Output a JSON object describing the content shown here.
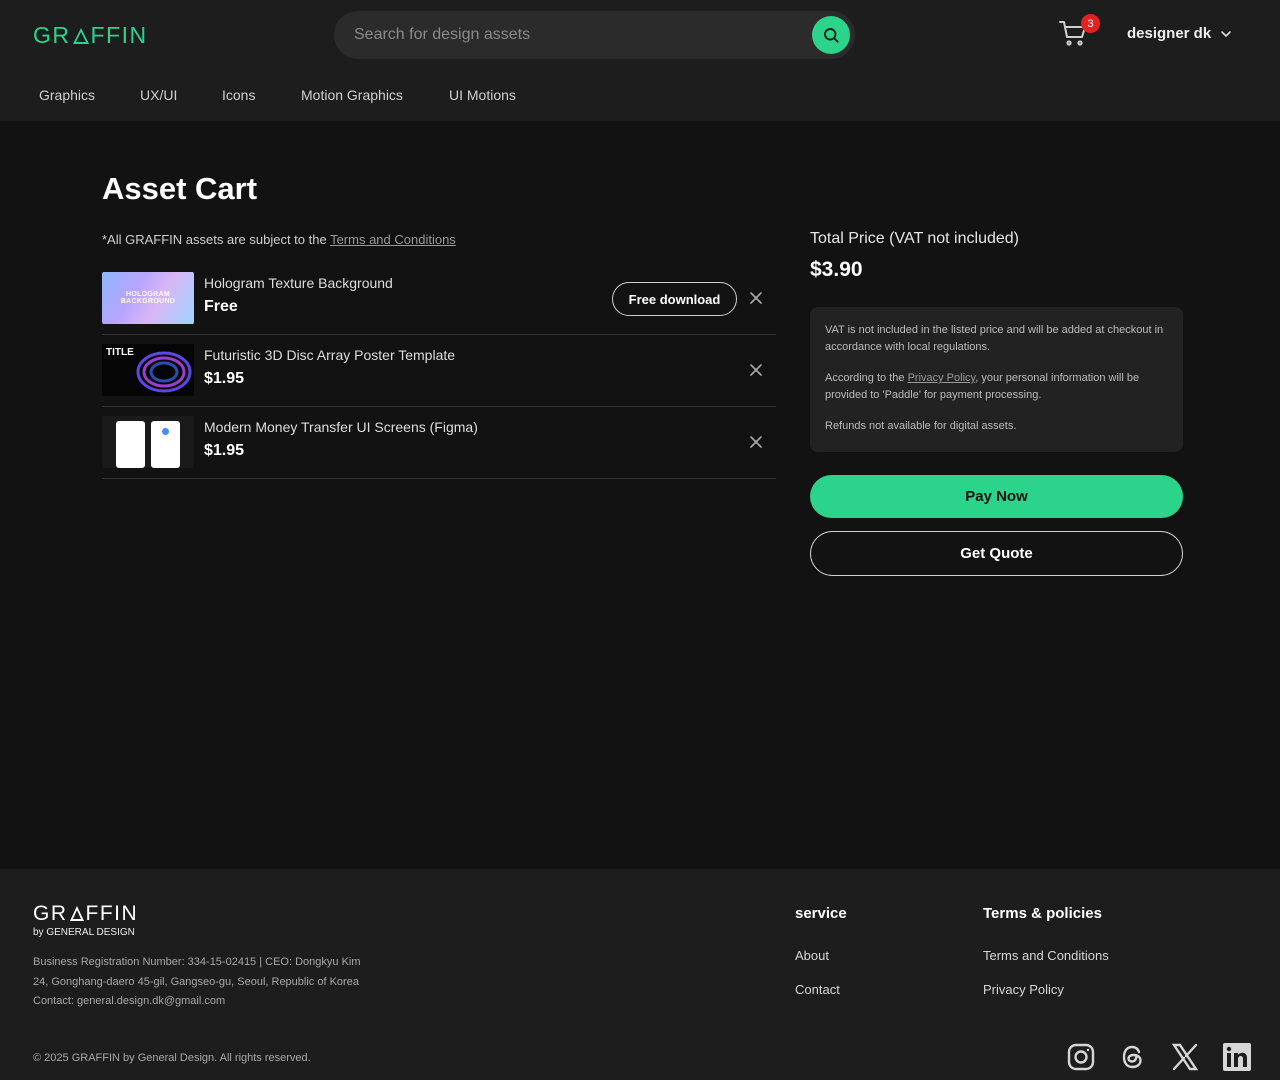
{
  "header": {
    "logo": {
      "pre": "GR",
      "post": "FFIN"
    },
    "search_placeholder": "Search for design assets",
    "cart_count": "3",
    "user_name": "designer dk"
  },
  "nav": [
    "Graphics",
    "UX/UI",
    "Icons",
    "Motion Graphics",
    "UI Motions"
  ],
  "page": {
    "title": "Asset Cart",
    "terms_note_prefix": "*All GRAFFIN assets are subject to the ",
    "terms_note_link": "Terms and Conditions"
  },
  "cart_items": [
    {
      "name": "Hologram Texture Background",
      "price": "Free",
      "action": "Free download",
      "thumb_text": [
        "HOLOGRAM",
        "BACKGROUND"
      ]
    },
    {
      "name": "Futuristic 3D Disc Array Poster Template",
      "price": "$1.95",
      "thumb_text": [
        "TITLE"
      ]
    },
    {
      "name": "Modern Money Transfer UI Screens (Figma)",
      "price": "$1.95"
    }
  ],
  "summary": {
    "total_label": "Total Price (VAT not included)",
    "total_value": "$3.90",
    "notice_vat": "VAT is not included in the listed price and will be added at checkout in accordance with local regulations.",
    "notice_privacy_prefix": "According to the ",
    "notice_privacy_link": "Privacy Policy",
    "notice_privacy_suffix": ", your personal information will be provided to 'Paddle' for payment processing.",
    "notice_refund": "Refunds not available for digital assets.",
    "pay_label": "Pay Now",
    "quote_label": "Get Quote"
  },
  "footer": {
    "logo": {
      "pre": "GR",
      "post": "FFIN"
    },
    "by": "by GENERAL DESIGN",
    "info": [
      "Business Registration Number: 334-15-02415 | CEO: Dongkyu Kim",
      "24, Gonghang-daero 45-gil, Gangseo-gu, Seoul, Republic of Korea",
      "Contact: general.design.dk@gmail.com"
    ],
    "copyright": "© 2025 GRAFFIN by General Design. All rights reserved.",
    "service_title": "service",
    "service_links": [
      "About",
      "Contact"
    ],
    "policies_title": "Terms & policies",
    "policies_links": [
      "Terms and Conditions",
      "Privacy Policy"
    ],
    "social_icons": [
      "instagram-icon",
      "threads-icon",
      "x-icon",
      "linkedin-icon"
    ]
  },
  "colors": {
    "accent": "#2bd38b",
    "badge": "#e32222",
    "background": "#121212",
    "panel": "#1d1d1d"
  }
}
